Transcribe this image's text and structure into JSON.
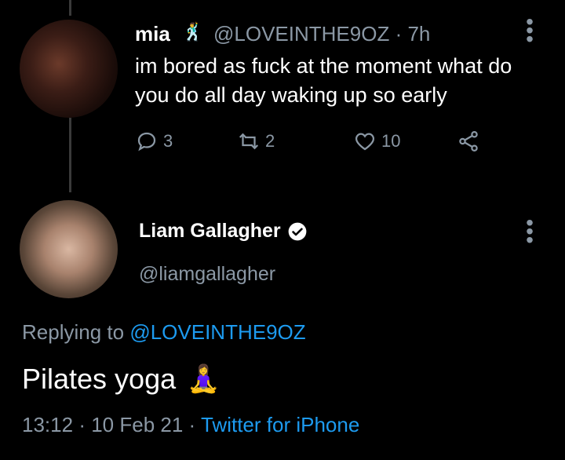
{
  "tweet1": {
    "display_name": "mia",
    "name_emoji": "🕺",
    "handle": "@LOVEINTHE9OZ",
    "separator": "·",
    "time": "7h",
    "text": "im bored as fuck at the moment what do you do all day waking up so early",
    "actions": {
      "reply_count": "3",
      "retweet_count": "2",
      "like_count": "10"
    }
  },
  "tweet2": {
    "display_name": "Liam Gallagher",
    "handle": "@liamgallagher",
    "replying_prefix": "Replying to",
    "replying_handle": "@LOVEINTHE9OZ",
    "text": "Pilates yoga",
    "emoji": "🧘‍♀️",
    "time": "13:12",
    "sep1": "·",
    "date": "10 Feb 21",
    "sep2": "·",
    "source": "Twitter for iPhone"
  },
  "colors": {
    "background": "#000000",
    "muted": "#8b98a5",
    "link": "#1d9bf0"
  },
  "icons": [
    "reply-icon",
    "retweet-icon",
    "like-icon",
    "share-icon",
    "more-icon",
    "verified-badge-icon"
  ]
}
